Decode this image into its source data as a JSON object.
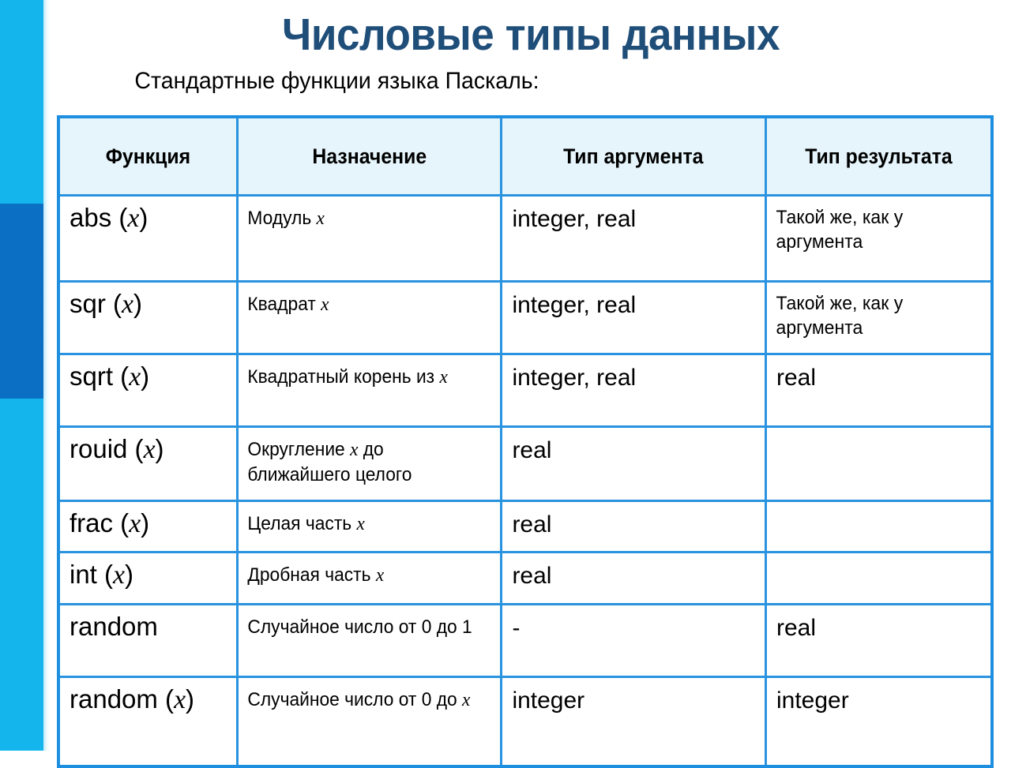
{
  "slide": {
    "title": "Числовые типы данных",
    "subtitle": "Стандартные функции языка Паскаль:",
    "title_color": "#1f4e79",
    "band_color": "#14b4ec",
    "band_accent_color": "#0b6fc4",
    "table_border_color": "#2a93e0",
    "header_fill_color": "#e6f5fb"
  },
  "table": {
    "headers": [
      "Функция",
      "Назначение",
      "Тип аргумента",
      "Тип результата"
    ],
    "rows": [
      {
        "function_name": "abs",
        "function_arg": "(x)",
        "purpose": "Модуль  x",
        "purpose_pre": "Модуль ",
        "purpose_var": "x",
        "purpose_post": "",
        "arg_type": "integer, real",
        "result_type": "Такой же, как у аргумента"
      },
      {
        "function_name": "sqr",
        "function_arg": "(x)",
        "purpose": "Квадрат x",
        "purpose_pre": "Квадрат ",
        "purpose_var": "x",
        "purpose_post": "",
        "arg_type": "integer, real",
        "result_type": "Такой же, как у аргумента"
      },
      {
        "function_name": "sqrt",
        "function_arg": "(x)",
        "purpose": "Квадратный корень из x",
        "purpose_pre": "Квадратный корень из ",
        "purpose_var": "x",
        "purpose_post": "",
        "arg_type": "integer, real",
        "result_type": "real"
      },
      {
        "function_name": "rouid",
        "function_arg": "(x)",
        "purpose": "Округление  x до ближайшего целого",
        "purpose_pre": "Округление ",
        "purpose_var": "x",
        "purpose_post": " до ближайшего целого",
        "arg_type": "real",
        "result_type": ""
      },
      {
        "function_name": "frac",
        "function_arg": "(x)",
        "purpose": "Целая часть x",
        "purpose_pre": "Целая часть ",
        "purpose_var": "x",
        "purpose_post": "",
        "arg_type": "real",
        "result_type": ""
      },
      {
        "function_name": "int",
        "function_arg": "(x)",
        "purpose": "Дробная часть x",
        "purpose_pre": "Дробная часть ",
        "purpose_var": "x",
        "purpose_post": "",
        "arg_type": "real",
        "result_type": ""
      },
      {
        "function_name": "random",
        "function_arg": "",
        "purpose": "Случайное число от 0 до 1",
        "purpose_pre": "Случайное число от 0 до 1",
        "purpose_var": "",
        "purpose_post": "",
        "arg_type": "-",
        "result_type": "real"
      },
      {
        "function_name": "random",
        "function_arg": "(x)",
        "purpose": "Случайное число от 0 до x",
        "purpose_pre": "Случайное число от 0 до ",
        "purpose_var": "x",
        "purpose_post": "",
        "arg_type": "integer",
        "result_type": "integer"
      }
    ]
  }
}
